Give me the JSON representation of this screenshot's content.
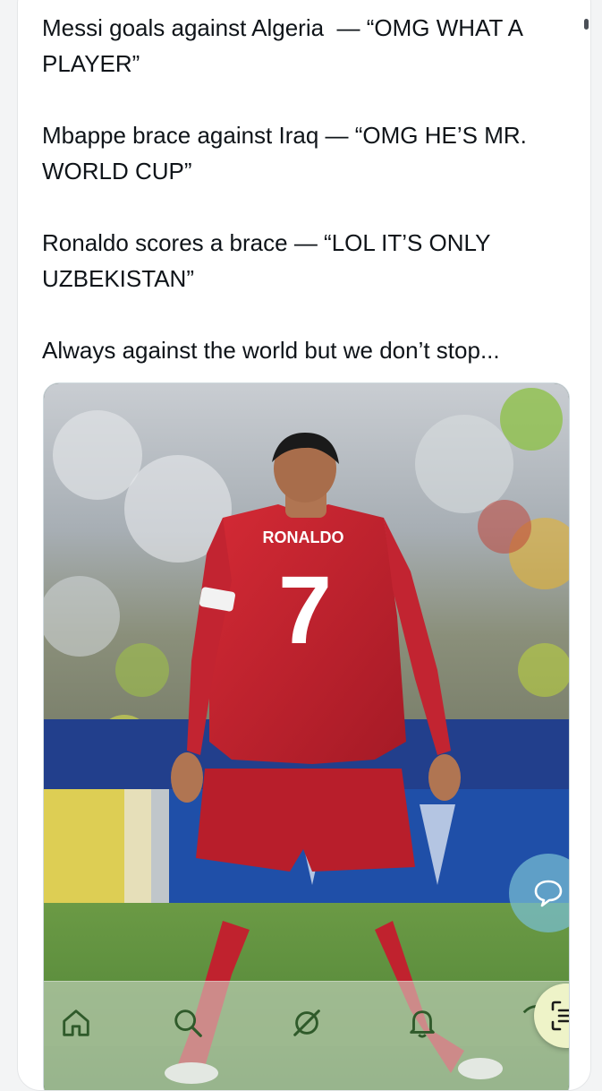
{
  "post": {
    "paragraphs": [
      "Messi goals against Algeria  — “OMG WHAT A PLAYER”",
      "Mbappe brace against Iraq — “OMG HE’S MR. WORLD CUP”",
      "Ronaldo scores a brace — “LOL IT’S ONLY UZBEKISTAN”",
      "Always against the world but we don’t stop..."
    ]
  },
  "media": {
    "jersey_name": "RONALDO",
    "jersey_number": "7",
    "colors": {
      "jersey": "#c0222e",
      "pitch": "#4f8a3c",
      "board": "#1f4fa8"
    }
  },
  "bottom_nav": {
    "items": [
      {
        "icon": "home-icon"
      },
      {
        "icon": "search-icon"
      },
      {
        "icon": "grok-icon"
      },
      {
        "icon": "bell-icon"
      },
      {
        "icon": "messages-icon"
      }
    ]
  },
  "floating_buttons": {
    "chat_icon": "chat-bubble-icon",
    "scan_icon": "scan-text-icon"
  }
}
